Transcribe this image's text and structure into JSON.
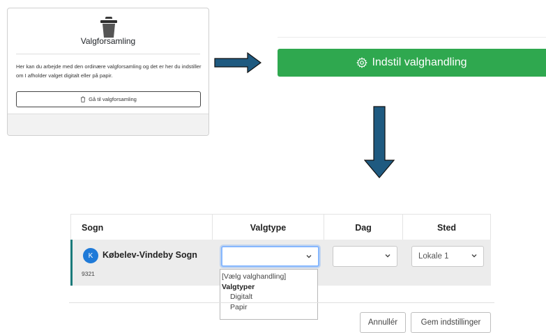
{
  "card": {
    "title": "Valgforsamling",
    "description": "Her kan du arbejde med den ordinære valgforsamling og det er her du indstiller om I afholder valget digitalt eller på papir.",
    "button_label": "Gå til valgforsamling",
    "icon": "trash-icon"
  },
  "setup_button": {
    "label": "Indstil valghandling",
    "icon": "gear-icon",
    "color": "#2fa84f"
  },
  "table": {
    "columns": [
      "Sogn",
      "Valgtype",
      "Dag",
      "Sted"
    ],
    "rows": [
      {
        "avatar_letter": "K",
        "parish_name": "Købelev-Vindeby Sogn",
        "parish_number": "9321",
        "valgtype_value": "",
        "dag_value": "",
        "sted_value": "Lokale 1"
      }
    ]
  },
  "valgtype_dropdown": {
    "placeholder_option": "[Vælg valghandling]",
    "group_label": "Valgtyper",
    "options": [
      "Digitalt",
      "Papir"
    ]
  },
  "actions": {
    "cancel_label": "Annullér",
    "save_label": "Gem indstillinger"
  },
  "colors": {
    "accent_green": "#2fa84f",
    "arrow_fill": "#1f5a80",
    "avatar_blue": "#1f7ad8",
    "row_marker": "#1a7a7a"
  }
}
